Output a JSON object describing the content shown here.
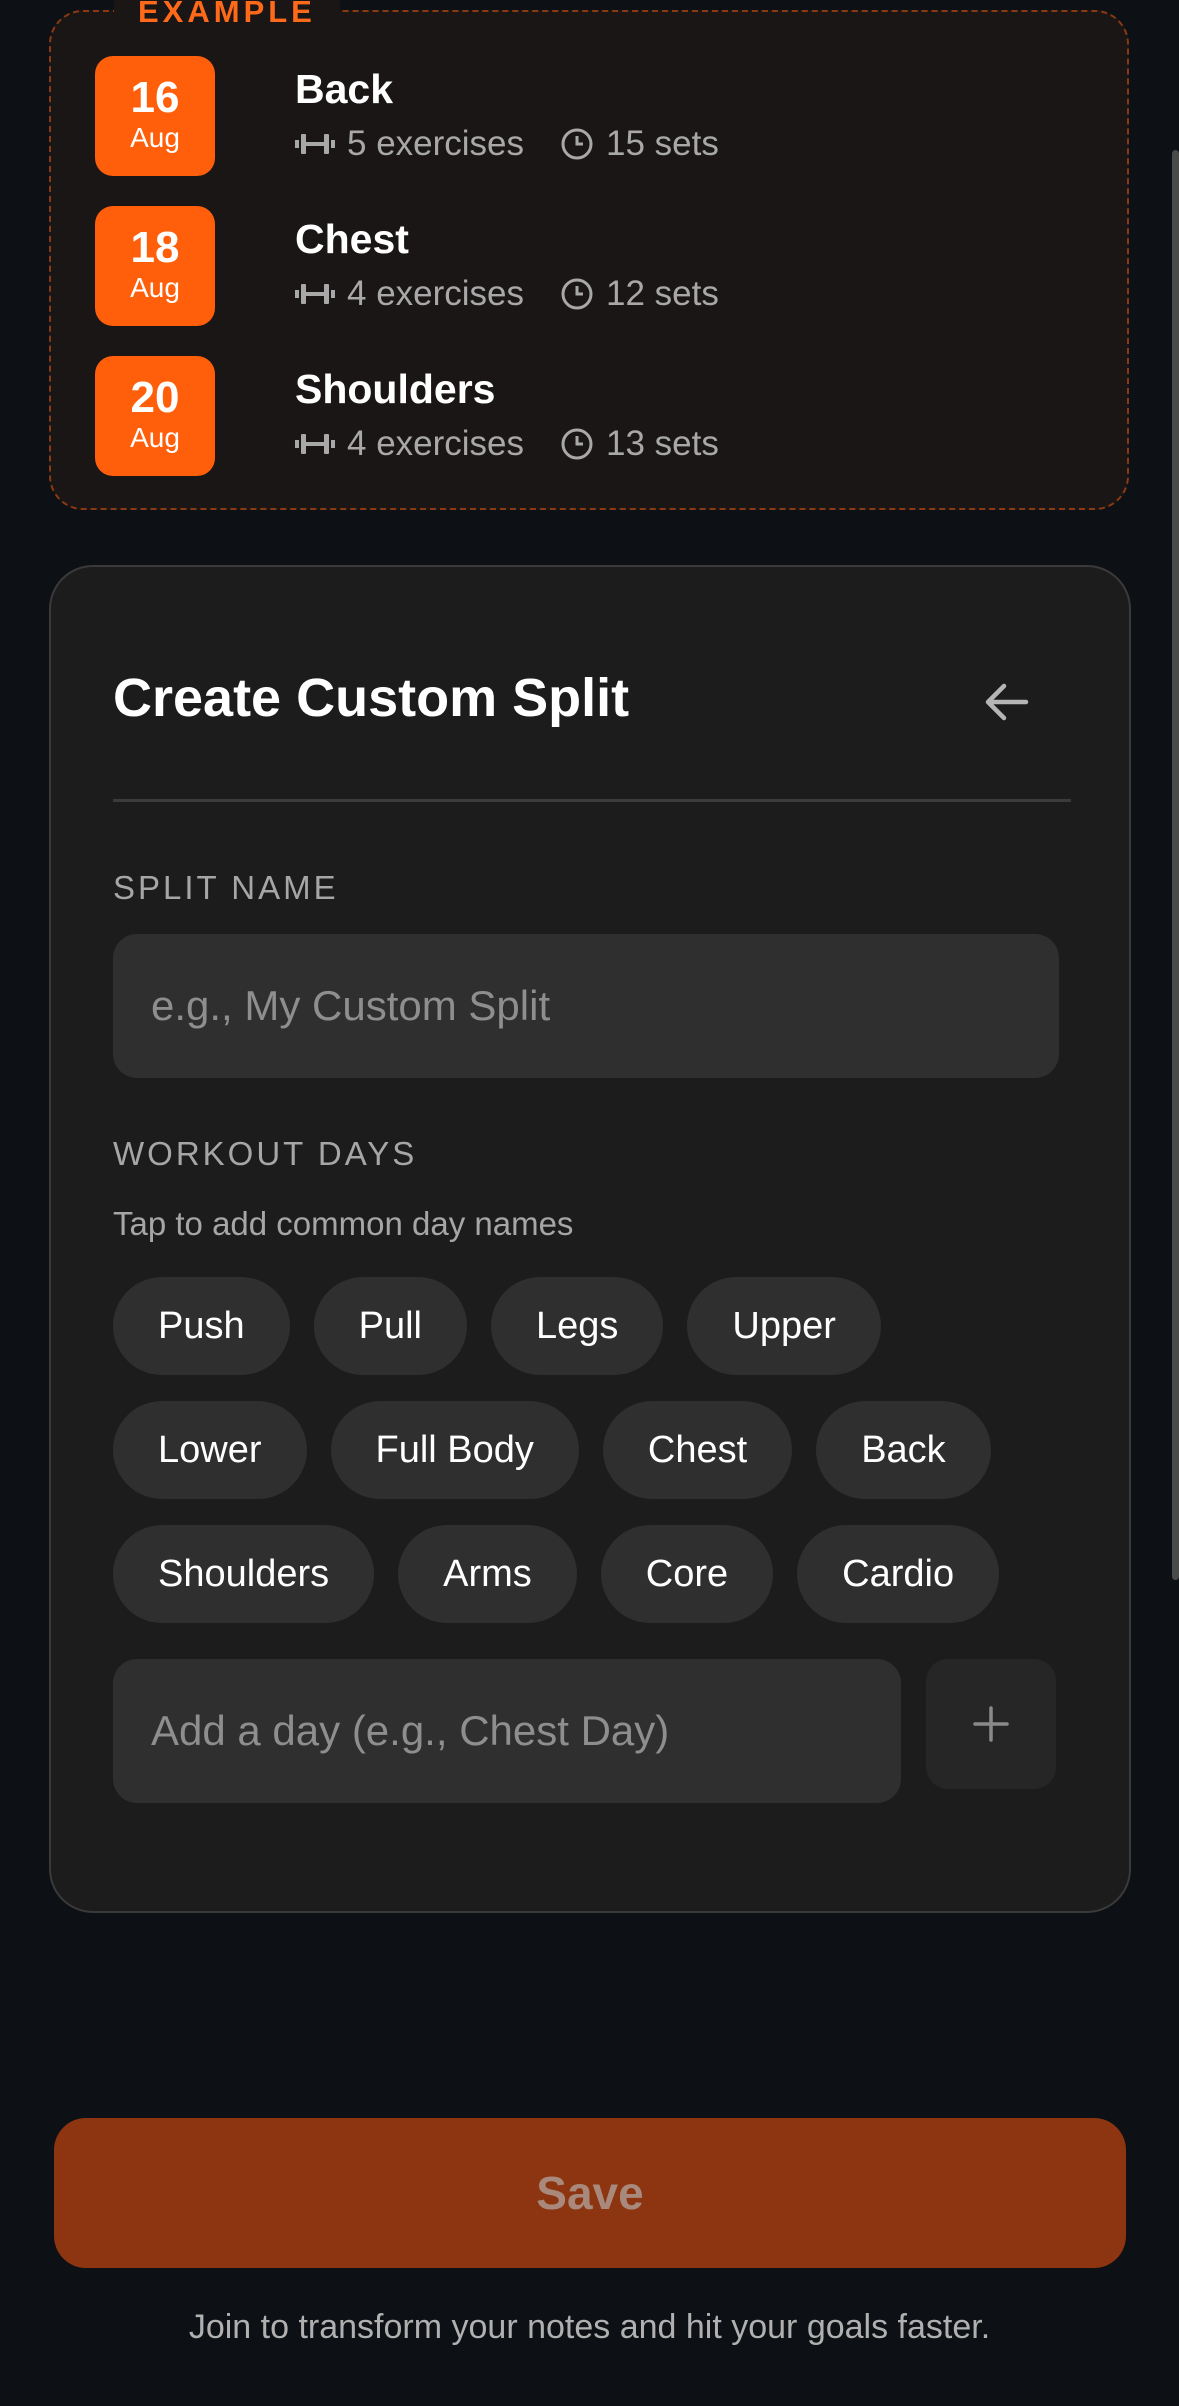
{
  "example": {
    "tag": "EXAMPLE",
    "rows": [
      {
        "day": "16",
        "month": "Aug",
        "title": "Back",
        "exercises": "5 exercises",
        "sets": "15 sets"
      },
      {
        "day": "18",
        "month": "Aug",
        "title": "Chest",
        "exercises": "4 exercises",
        "sets": "12 sets"
      },
      {
        "day": "20",
        "month": "Aug",
        "title": "Shoulders",
        "exercises": "4 exercises",
        "sets": "13 sets"
      }
    ]
  },
  "custom_split": {
    "title": "Create Custom Split",
    "split_name_label": "SPLIT NAME",
    "split_name_placeholder": "e.g., My Custom Split",
    "workout_days_label": "WORKOUT DAYS",
    "hint": "Tap to add common day names",
    "chips": [
      [
        "Push",
        "Pull",
        "Legs",
        "Upper"
      ],
      [
        "Lower",
        "Full Body",
        "Chest",
        "Back"
      ],
      [
        "Shoulders",
        "Arms",
        "Core",
        "Cardio"
      ]
    ],
    "add_day_placeholder": "Add a day (e.g., Chest Day)"
  },
  "save_label": "Save",
  "footer_text": "Join to transform your notes and hit your goals faster.",
  "colors": {
    "accent": "#ff5f0a",
    "background": "#0d1014",
    "card": "#1c1c1d",
    "save": "#8c3510"
  }
}
